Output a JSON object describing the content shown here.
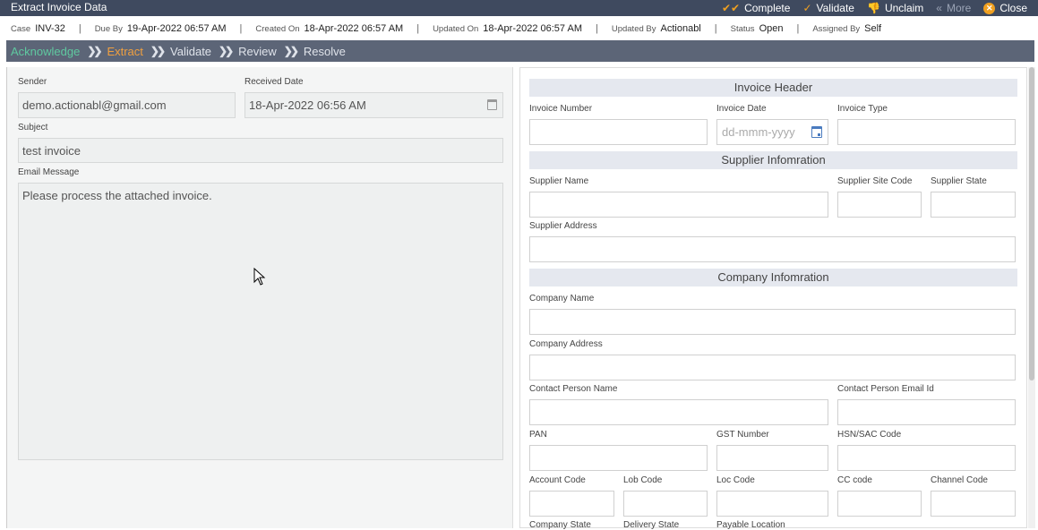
{
  "window": {
    "title": "Extract Invoice Data"
  },
  "toolbar": {
    "complete": "Complete",
    "validate": "Validate",
    "unclaim": "Unclaim",
    "more": "More",
    "close": "Close"
  },
  "info": {
    "case_label": "Case",
    "case_value": "INV-32",
    "due_label": "Due By",
    "due_value": "19-Apr-2022 06:57 AM",
    "created_label": "Created On",
    "created_value": "18-Apr-2022 06:57 AM",
    "updated_label": "Updated On",
    "updated_value": "18-Apr-2022 06:57 AM",
    "updatedby_label": "Updated By",
    "updatedby_value": "Actionabl",
    "status_label": "Status",
    "status_value": "Open",
    "assigned_label": "Assigned By",
    "assigned_value": "Self"
  },
  "steps": [
    "Acknowledge",
    "Extract",
    "Validate",
    "Review",
    "Resolve"
  ],
  "email": {
    "sender_label": "Sender",
    "sender_value": "demo.actionabl@gmail.com",
    "received_label": "Received Date",
    "received_value": "18-Apr-2022 06:56 AM",
    "subject_label": "Subject",
    "subject_value": "test invoice",
    "message_label": "Email Message",
    "message_value": "Please process the attached invoice."
  },
  "invoice_header": {
    "title": "Invoice Header",
    "invoice_number_label": "Invoice Number",
    "invoice_date_label": "Invoice Date",
    "invoice_date_placeholder": "dd-mmm-yyyy",
    "invoice_type_label": "Invoice Type"
  },
  "supplier": {
    "title": "Supplier Infomration",
    "name_label": "Supplier Name",
    "site_code_label": "Supplier Site Code",
    "state_label": "Supplier State",
    "address_label": "Supplier Address"
  },
  "company": {
    "title": "Company Infomration",
    "name_label": "Company Name",
    "address_label": "Company Address",
    "contact_name_label": "Contact Person Name",
    "contact_email_label": "Contact Person Email Id",
    "pan_label": "PAN",
    "gst_label": "GST Number",
    "hsn_label": "HSN/SAC Code",
    "account_code_label": "Account Code",
    "lob_code_label": "Lob Code",
    "loc_code_label": "Loc Code",
    "cc_code_label": "CC code",
    "channel_code_label": "Channel Code",
    "company_state_label": "Company State",
    "delivery_state_label": "Delivery State",
    "payable_location_label": "Payable Location"
  }
}
